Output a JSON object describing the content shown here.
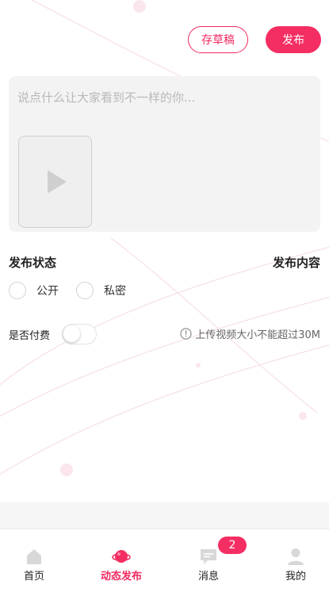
{
  "toolbar": {
    "draft_label": "存草稿",
    "publish_label": "发布"
  },
  "compose": {
    "placeholder": "说点什么让大家看到不一样的你..."
  },
  "status_section": {
    "title": "发布状态",
    "options": [
      {
        "label": "公开",
        "selected": false
      },
      {
        "label": "私密",
        "selected": false
      }
    ]
  },
  "content_section": {
    "title": "发布内容"
  },
  "payment": {
    "label": "是否付费",
    "enabled": false
  },
  "upload_hint": {
    "text": "上传视频大小不能超过30M"
  },
  "tabbar": {
    "items": [
      {
        "label": "首页",
        "icon": "home-icon",
        "active": false
      },
      {
        "label": "动态发布",
        "icon": "publish-icon",
        "active": true
      },
      {
        "label": "消息",
        "icon": "message-icon",
        "active": false,
        "badge": "2"
      },
      {
        "label": "我的",
        "icon": "user-icon",
        "active": false
      }
    ]
  },
  "colors": {
    "accent": "#f42e63",
    "inactive_icon": "#d8d8d8",
    "compose_bg": "#f3f3f3"
  }
}
